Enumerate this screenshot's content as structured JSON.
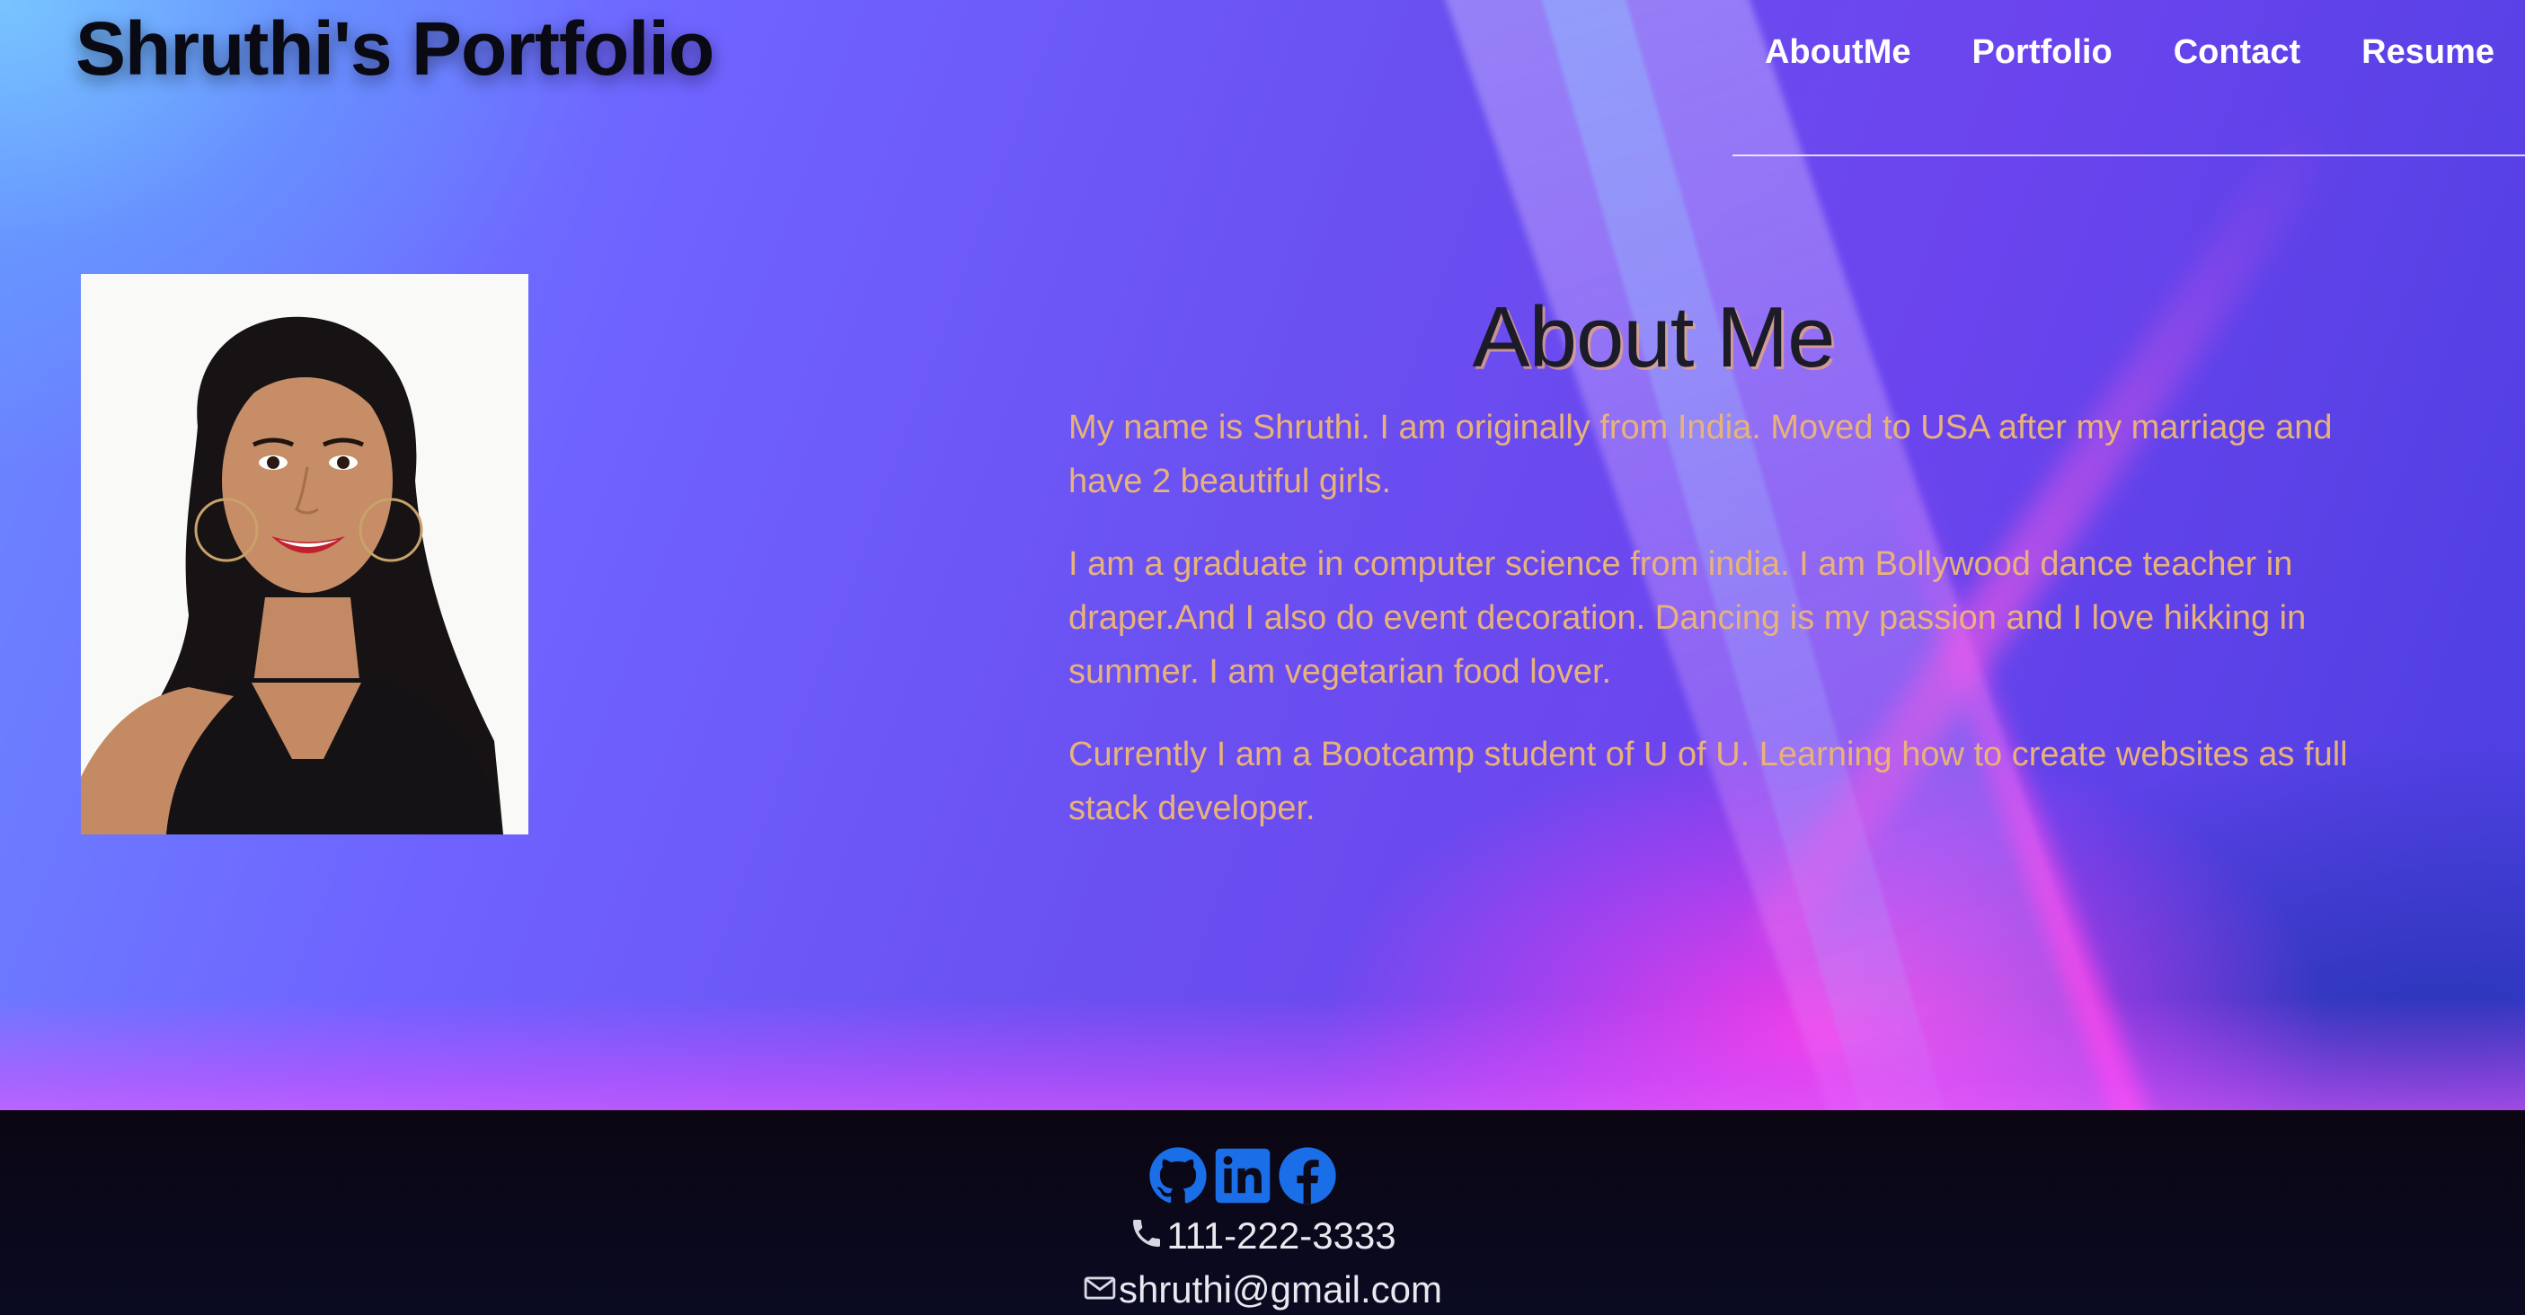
{
  "header": {
    "site_title": "Shruthi's Portfolio",
    "nav": [
      {
        "label": "AboutMe"
      },
      {
        "label": "Portfolio"
      },
      {
        "label": "Contact"
      },
      {
        "label": "Resume"
      }
    ]
  },
  "about": {
    "heading": "About Me",
    "paragraphs": [
      "My name is Shruthi. I am originally from India. Moved to USA after my marriage and have 2 beautiful girls.",
      "I am a graduate in computer science from india. I am Bollywood dance teacher in draper.And I also do event decoration. Dancing is my passion and I love hikking in summer. I am vegetarian food lover.",
      "Currently I am a Bootcamp student of U of U. Learning how to create websites as full stack developer."
    ],
    "photo_icon": "profile-photo"
  },
  "footer": {
    "social": [
      {
        "icon": "github-icon"
      },
      {
        "icon": "linkedin-icon"
      },
      {
        "icon": "facebook-icon"
      }
    ],
    "phone": "111-222-3333",
    "email": "shruthi@gmail.com"
  },
  "colors": {
    "title": "#0a0a14",
    "nav": "#ffffff",
    "about_text": "#e8b279",
    "social_icons": "#1a6fe8",
    "footer_bg": "#0b0612"
  }
}
